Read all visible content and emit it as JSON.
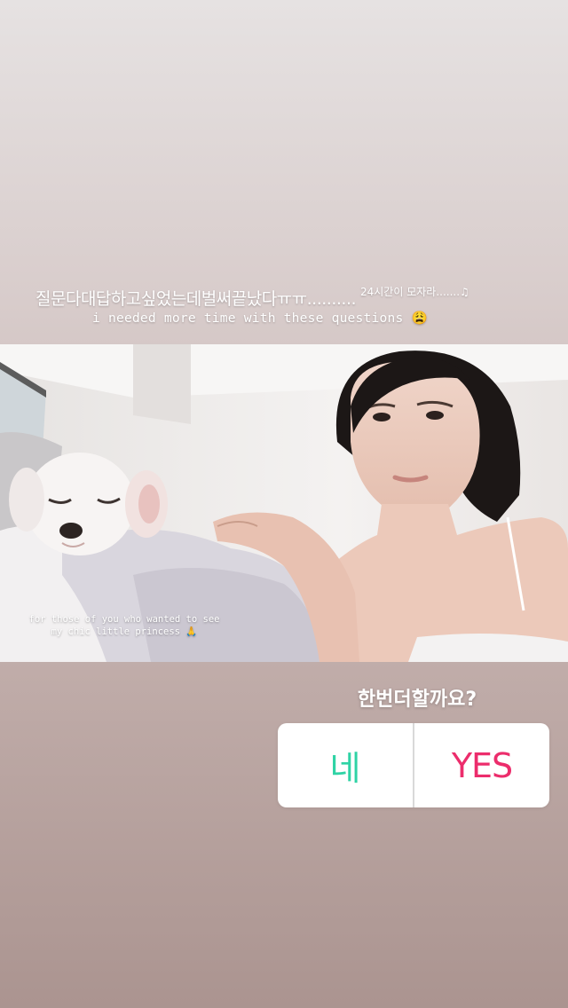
{
  "story": {
    "caption_korean": "질문다대답하고싶었는데벌써끝났다ㅠㅠ..........",
    "caption_small": "24시간이 모자라.......♫",
    "caption_english": "i needed more time with these questions 😩",
    "photo_caption": "for those of you who wanted to see my chic little princess 🙏"
  },
  "poll": {
    "question": "한번더할까요?",
    "option_left": "네",
    "option_right": "YES"
  },
  "colors": {
    "option_left": "#2fd3a5",
    "option_right": "#ec2d6c",
    "poll_background": "#ffffff"
  }
}
